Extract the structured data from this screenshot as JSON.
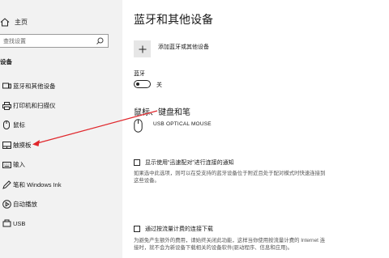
{
  "sidebar": {
    "home_label": "主页",
    "search_placeholder": "查找设置",
    "section_title": "设备",
    "items": [
      {
        "label": "蓝牙和其他设备",
        "icon": "bluetooth-devices-icon"
      },
      {
        "label": "打印机和扫描仪",
        "icon": "printer-icon"
      },
      {
        "label": "鼠标",
        "icon": "mouse-icon"
      },
      {
        "label": "触摸板",
        "icon": "touchpad-icon"
      },
      {
        "label": "输入",
        "icon": "keyboard-icon"
      },
      {
        "label": "笔和 Windows Ink",
        "icon": "pen-icon"
      },
      {
        "label": "自动播放",
        "icon": "autoplay-icon"
      },
      {
        "label": "USB",
        "icon": "usb-icon"
      }
    ]
  },
  "main": {
    "title": "蓝牙和其他设备",
    "add_device_label": "添加蓝牙或其他设备",
    "bluetooth_label": "蓝牙",
    "bluetooth_state": "关",
    "bluetooth_on": false,
    "section_title": "鼠标、键盘和笔",
    "device_name": "USB OPTICAL MOUSE",
    "swift_pair": {
      "label": "显示使用“迅速配对”进行连接的通知",
      "checked": false,
      "description": "如果选中此选项，则可以在受支持的蓝牙设备位于附近且处于配对模式时快速连接到这些设备。"
    },
    "metered": {
      "label": "通过按流量计费的连接下载",
      "checked": false,
      "description": "为避免产生额外的费用，请始终关闭此功能，这样当你使用按流量计费的 Internet 连接时，就不会为新设备下载相关的设备软件(驱动程序、信息和应用)。"
    }
  },
  "annotation": {
    "color": "#e0262b"
  }
}
